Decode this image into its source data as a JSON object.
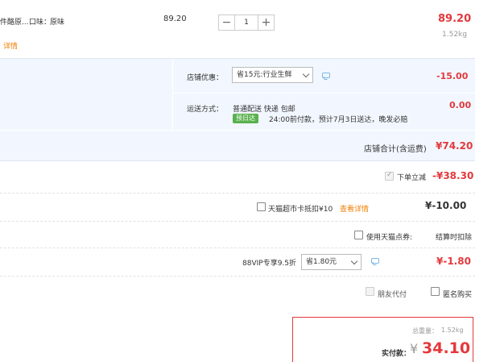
{
  "item": {
    "title_fragment": "件酪原...",
    "flavor_label": "口味：",
    "flavor_value": "原味",
    "detail_link": "详情",
    "unit_price": "89.20",
    "qty_minus": "−",
    "quantity": "1",
    "qty_plus": "+",
    "subtotal": "89.20",
    "weight": "1.52kg"
  },
  "shop": {
    "discount_label": "店铺优惠：",
    "discount_select": "省15元:行业生鲜",
    "discount_amount": "-15.00",
    "shipping_label": "运送方式：",
    "shipping_methods": "普通配送 快递 包邮",
    "delivery_badge": "预日达",
    "delivery_note": "24:00前付款，预计7月3日送达，晚发必赔",
    "shipping_fee": "0.00",
    "total_label": "店铺合计(含运费)",
    "total_value": "¥74.20"
  },
  "order": {
    "instant_discount_label": "下单立减",
    "instant_discount_value": "-¥38.30",
    "supermarket_card_label": "天猫超市卡抵扣¥10",
    "supermarket_card_link": "查看详情",
    "supermarket_card_value": "¥-10.00",
    "points_label": "使用天猫点券:",
    "points_value": "结算时扣除",
    "vip_label": "88VIP专享9.5折",
    "vip_select": "省1.80元",
    "vip_value": "¥-1.80",
    "friend_pay_label": "朋友代付",
    "anonymous_label": "匿名购买"
  },
  "summary": {
    "weight_label": "总重量：",
    "weight_value": "1.52kg",
    "pay_label": "实付款：",
    "currency": "¥",
    "pay_value": "34.10"
  },
  "colors": {
    "price_red": "#e4393c",
    "link_orange": "#f27d00",
    "shop_bg": "#f2f7ff",
    "badge_green": "#59b14d"
  }
}
